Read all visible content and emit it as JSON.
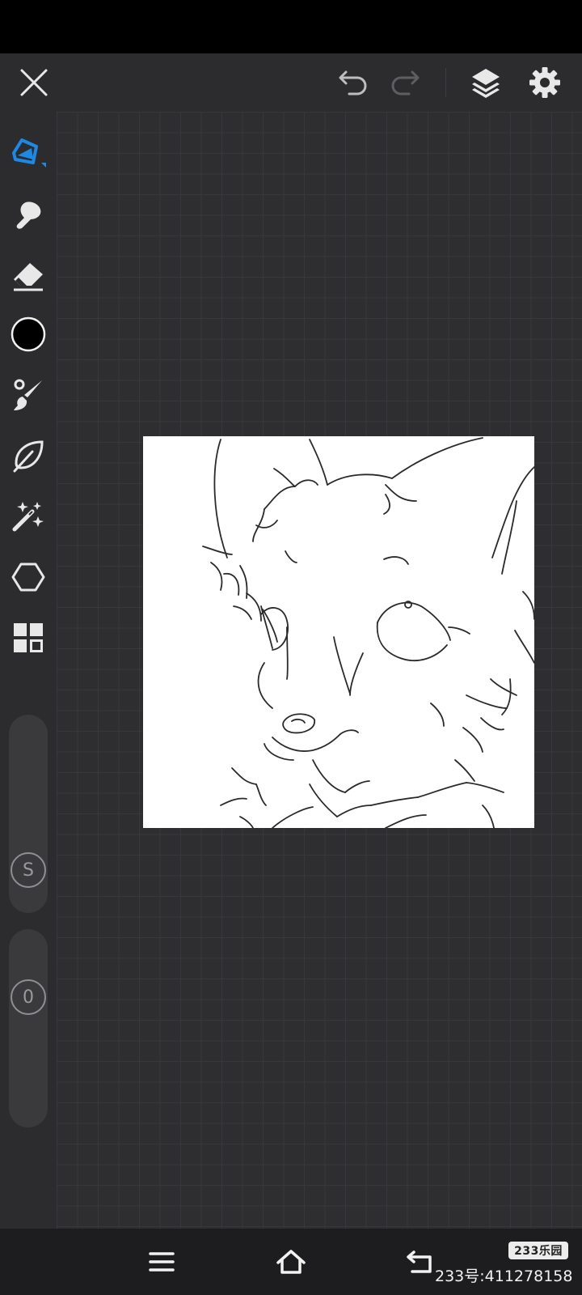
{
  "app": {
    "accent_color": "#1e88e5",
    "toolbar_bg": "#2c2c2e",
    "canvas_bg": "#2e2e31"
  },
  "toolbar": {
    "close": {
      "icon": "close-icon"
    },
    "undo": {
      "icon": "undo-icon",
      "enabled": true
    },
    "redo": {
      "icon": "redo-icon",
      "enabled": false
    },
    "layers": {
      "icon": "layers-icon"
    },
    "settings": {
      "icon": "gear-icon"
    }
  },
  "tools": [
    {
      "name": "pen",
      "icon": "pen-icon",
      "selected": true
    },
    {
      "name": "smudge",
      "icon": "smudge-icon"
    },
    {
      "name": "eraser",
      "icon": "eraser-icon"
    },
    {
      "name": "color",
      "icon": "color-swatch",
      "value": "#000000"
    },
    {
      "name": "brush",
      "icon": "brush-icon"
    },
    {
      "name": "lasso",
      "icon": "lasso-icon"
    },
    {
      "name": "magic",
      "icon": "magic-wand-icon"
    },
    {
      "name": "shape",
      "icon": "hexagon-icon"
    },
    {
      "name": "more",
      "icon": "grid-icon"
    }
  ],
  "sliders": {
    "size": {
      "label": "S"
    },
    "opacity": {
      "label": "0"
    }
  },
  "navbar": {
    "menu": {
      "icon": "menu-icon"
    },
    "home": {
      "icon": "home-icon"
    },
    "back": {
      "icon": "back-icon"
    }
  },
  "watermark": {
    "badge": "233乐园",
    "id_text": "233号:411278158"
  }
}
